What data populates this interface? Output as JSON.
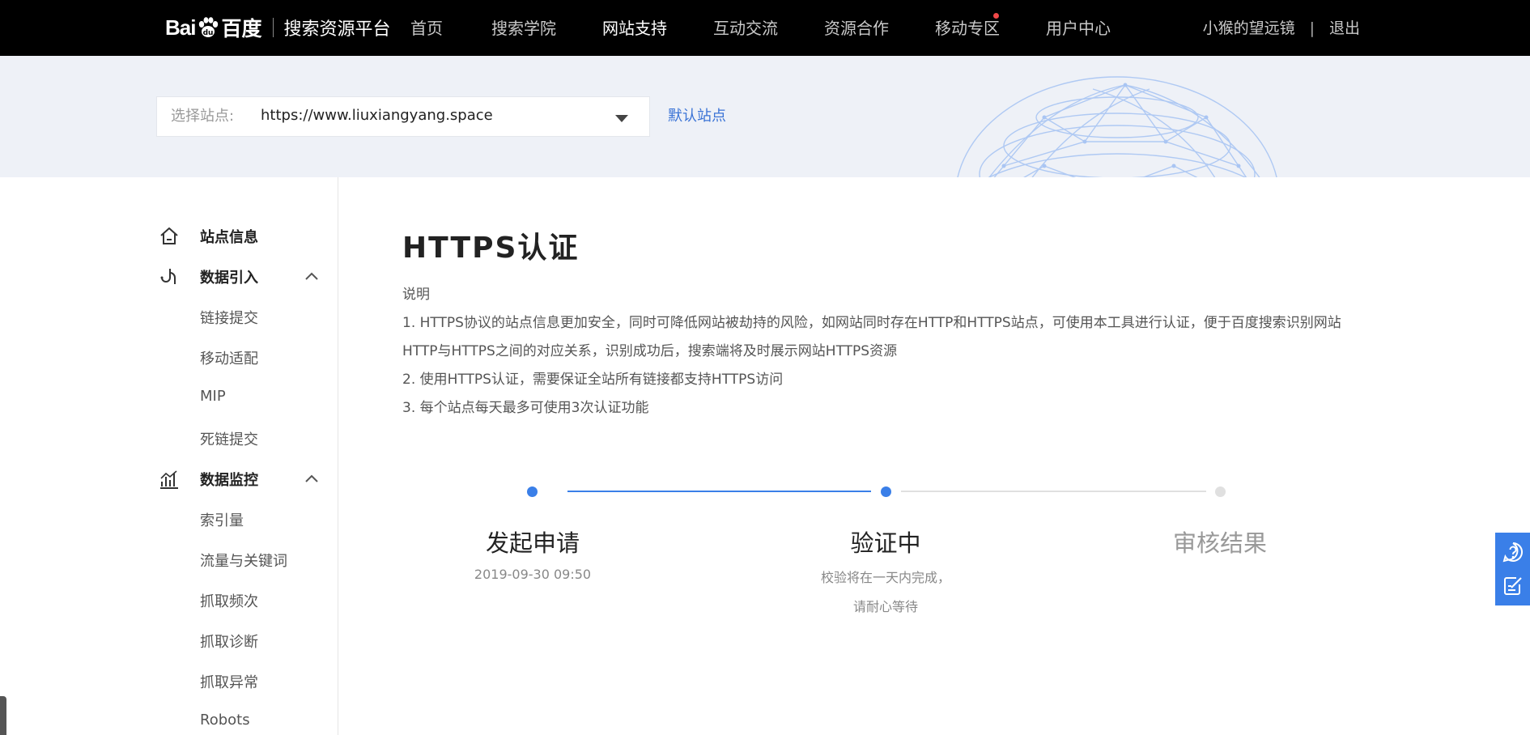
{
  "header": {
    "logo_bai": "Bai",
    "logo_du": "百度",
    "platform": "搜索资源平台",
    "nav": [
      {
        "label": "首页"
      },
      {
        "label": "搜索学院"
      },
      {
        "label": "网站支持"
      },
      {
        "label": "互动交流"
      },
      {
        "label": "资源合作"
      },
      {
        "label": "移动专区"
      },
      {
        "label": "用户中心"
      }
    ],
    "active_index": 2,
    "notice_dot_index": 5,
    "username": "小猴的望远镜",
    "separator": "|",
    "logout": "退出"
  },
  "site_selector": {
    "label": "选择站点:",
    "value": "https://www.liuxiangyang.space",
    "default_link": "默认站点"
  },
  "sidebar": {
    "groups": [
      {
        "title": "站点信息",
        "icon": "home-icon",
        "items": []
      },
      {
        "title": "数据引入",
        "icon": "data-import-icon",
        "expanded": true,
        "items": [
          "链接提交",
          "移动适配",
          "MIP",
          "死链提交"
        ]
      },
      {
        "title": "数据监控",
        "icon": "data-monitor-icon",
        "expanded": true,
        "items": [
          "索引量",
          "流量与关键词",
          "抓取频次",
          "抓取诊断",
          "抓取异常",
          "Robots"
        ]
      }
    ]
  },
  "main": {
    "title": "HTTPS认证",
    "desc_heading": "说明",
    "desc_lines": [
      "1. HTTPS协议的站点信息更加安全，同时可降低网站被劫持的风险，如网站同时存在HTTP和HTTPS站点，可使用本工具进行认证，便于百度搜索识别网站",
      "HTTP与HTTPS之间的对应关系，识别成功后，搜索端将及时展示网站HTTPS资源",
      "2. 使用HTTPS认证，需要保证全站所有链接都支持HTTPS访问",
      "3. 每个站点每天最多可使用3次认证功能"
    ]
  },
  "steps": [
    {
      "title": "发起申请",
      "sub": [
        "2019-09-30 09:50"
      ],
      "state": "done"
    },
    {
      "title": "验证中",
      "sub": [
        "校验将在一天内完成，",
        "请耐心等待"
      ],
      "state": "current"
    },
    {
      "title": "审核结果",
      "sub": [],
      "state": "pending"
    }
  ],
  "float_buttons": [
    {
      "icon": "help-icon"
    },
    {
      "icon": "feedback-edit-icon"
    }
  ],
  "colors": {
    "accent": "#3a7fe8",
    "link": "#3a73d6",
    "nav_bg": "#000000",
    "banner_bg": "#eef1f7",
    "step_pending": "#dddddd",
    "notice_dot": "#f04848"
  }
}
